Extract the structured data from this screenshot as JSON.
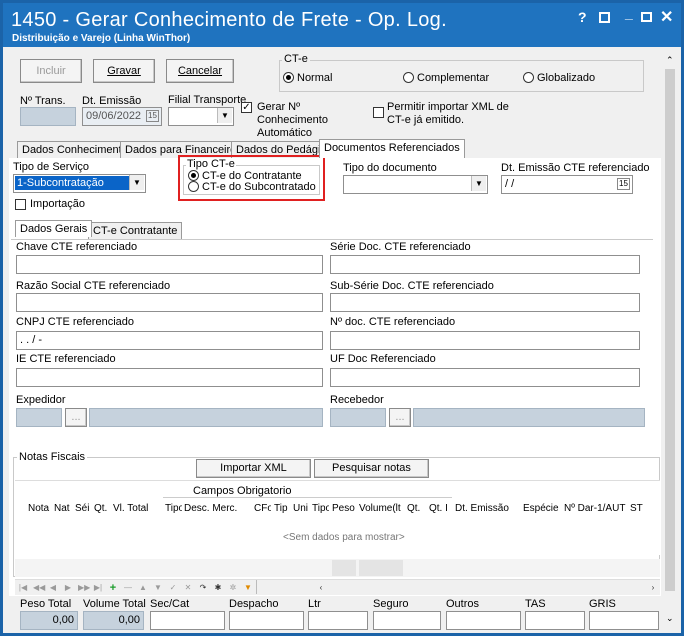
{
  "title": {
    "main": "1450 - Gerar Conhecimento de Frete - Op. Log.",
    "sub": "Distribuição e Varejo (Linha WinThor)",
    "help": "?",
    "min": "_"
  },
  "toolbar": {
    "incluir": "Incluir",
    "gravar": "Gravar",
    "cancelar": "Cancelar"
  },
  "cte_group": {
    "label": "CT-e",
    "normal": "Normal",
    "complementar": "Complementar",
    "globalizado": "Globalizado"
  },
  "header": {
    "ntrans_label": "Nº Trans.",
    "ntrans_value": "",
    "dt_emissao_label": "Dt. Emissão",
    "dt_emissao_value": "09/06/2022",
    "filial_label": "Filial Transporte",
    "filial_value": "",
    "gerar_label": "Gerar Nº Conhecimento Automático",
    "permitir_label": "Permitir importar XML de CT-e já emitido."
  },
  "tabs": [
    "Dados Conhecimento",
    "Dados para Financeiro",
    "Dados do Pedágio",
    "Documentos Referenciados"
  ],
  "docref": {
    "tipo_servico_label": "Tipo de Serviço",
    "tipo_servico_value": "1-Subcontratação",
    "tipo_cte_label": "Tipo CT-e",
    "cte_contratante": "CT-e do Contratante",
    "cte_subcontratado": "CT-e do Subcontratado",
    "tipo_doc_label": "Tipo do documento",
    "dt_emissao_ref_label": "Dt. Emissão CTE referenciado",
    "dt_emissao_ref_value": " / /",
    "importacao_label": "Importação"
  },
  "subtabs": [
    "Dados Gerais",
    "CT-e Contratante"
  ],
  "fields": {
    "chave": "Chave CTE referenciado",
    "serie": "Série Doc. CTE referenciado",
    "razao": "Razão Social CTE referenciado",
    "subserie": "Sub-Série Doc. CTE referenciado",
    "cnpj": "CNPJ CTE referenciado",
    "cnpj_value": " .  .  /  -",
    "ndoc": "Nº doc. CTE referenciado",
    "ie": "IE CTE referenciado",
    "uf": "UF Doc Referenciado",
    "expedidor": "Expedidor",
    "recebedor": "Recebedor",
    "ellipsis": "..."
  },
  "notas": {
    "label": "Notas Fiscais",
    "importar": "Importar XML",
    "pesquisar": "Pesquisar notas",
    "campos": "Campos Obrigatorio",
    "cols": [
      "Nota",
      "Nat",
      "Séi",
      "Qt.",
      "Vl. Total",
      "Tipo",
      "Desc. Merc.",
      "CFo",
      "Tip",
      "Uni",
      "Tipo",
      "Peso",
      "Volume(lt",
      "Qt.",
      "Qt. I",
      "Dt. Emissão",
      "Espécie",
      "Nº Dar-1/AUT",
      "ST"
    ],
    "empty": "<Sem dados para mostrar>"
  },
  "footer": {
    "peso": "Peso Total",
    "peso_v": "0,00",
    "volume": "Volume Total",
    "volume_v": "0,00",
    "seccat": "Sec/Cat",
    "despacho": "Despacho",
    "ltr": "Ltr",
    "seguro": "Seguro",
    "outros": "Outros",
    "tas": "TAS",
    "gris": "GRIS"
  }
}
